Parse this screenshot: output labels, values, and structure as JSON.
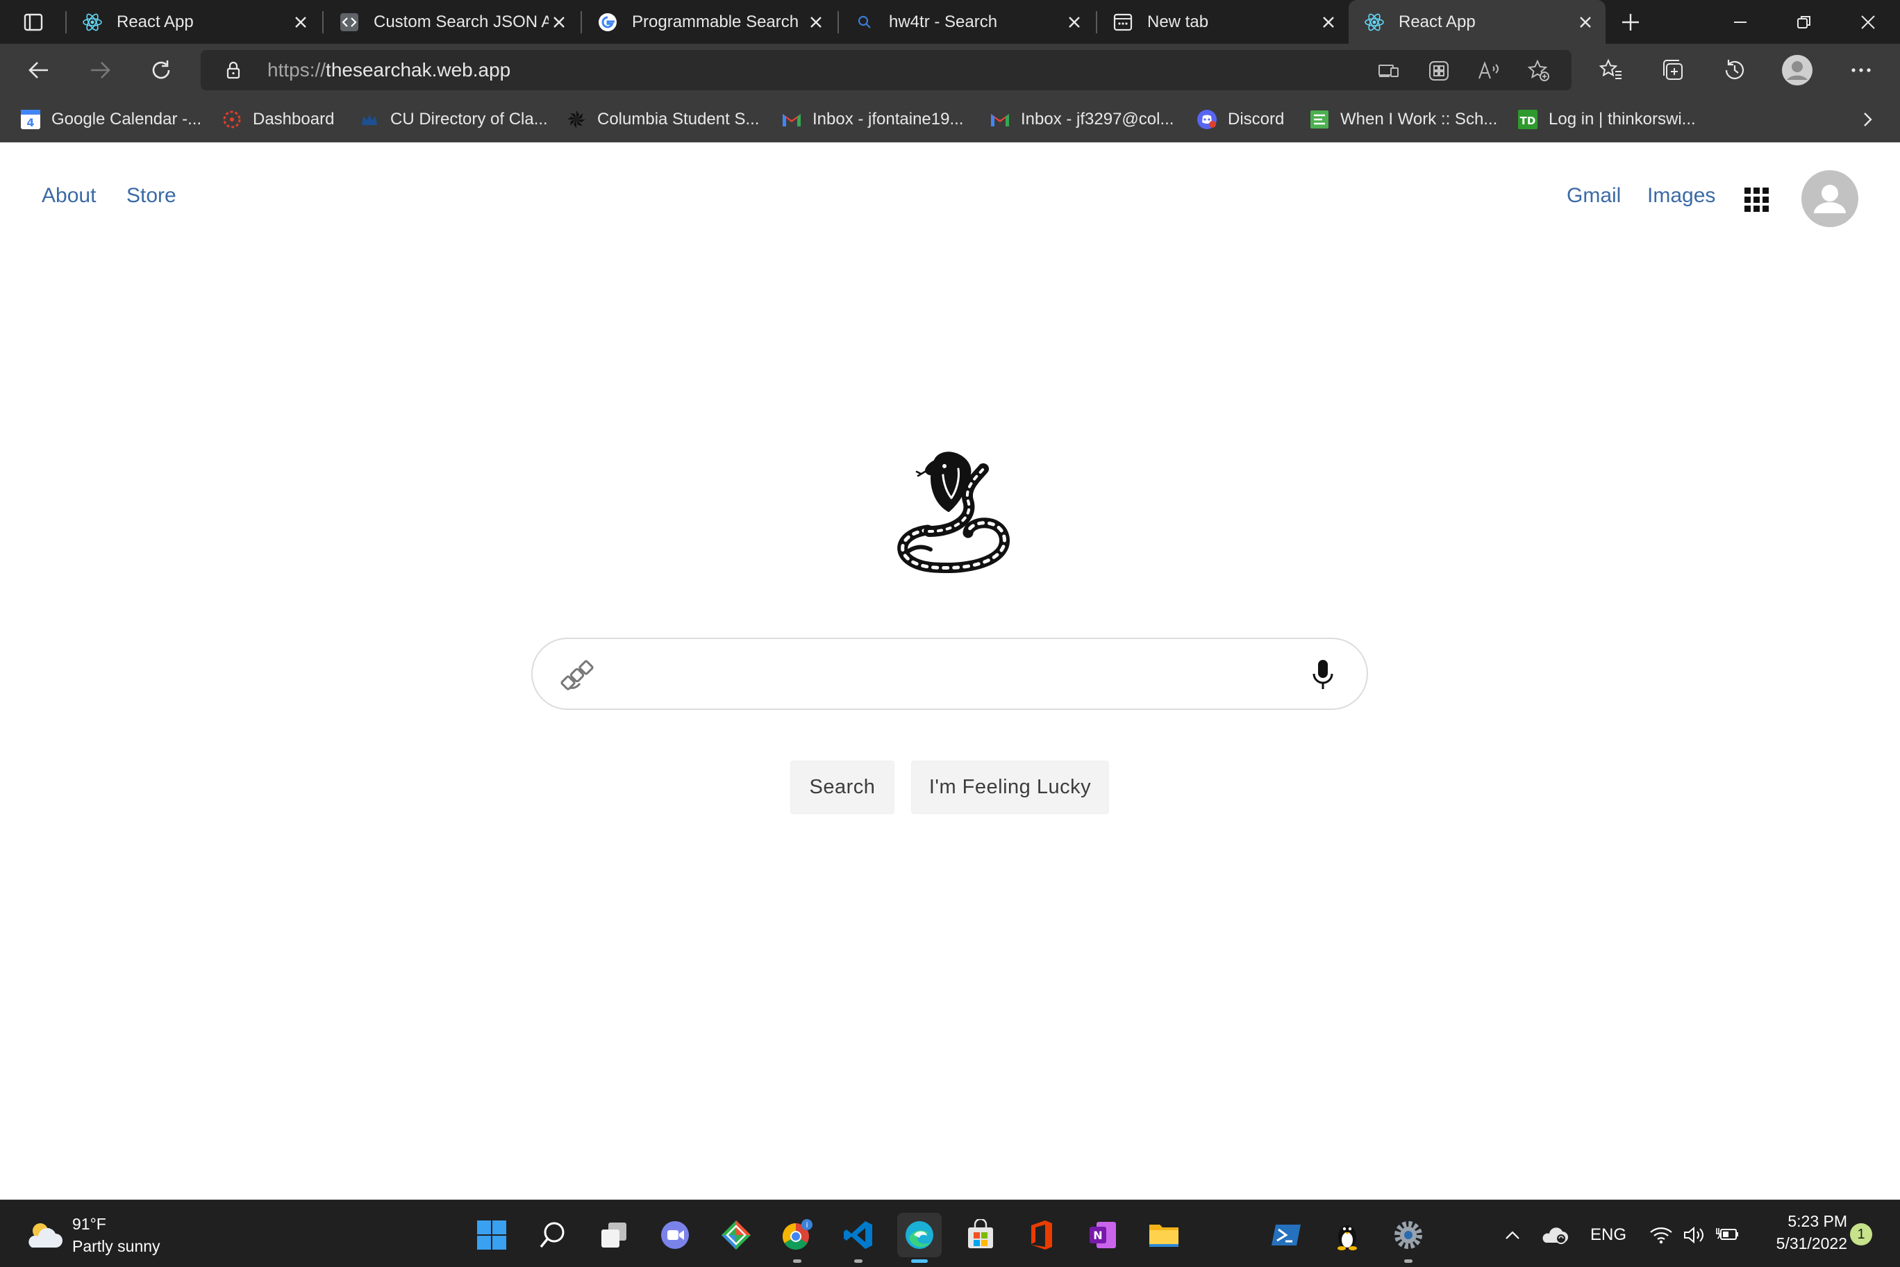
{
  "browser": {
    "tabs": [
      {
        "title": "React App",
        "icon": "react-icon",
        "active": false
      },
      {
        "title": "Custom Search JSON A",
        "icon": "api-explorer-icon",
        "active": false
      },
      {
        "title": "Programmable Search",
        "icon": "google-icon",
        "active": false
      },
      {
        "title": "hw4tr - Search",
        "icon": "search-icon",
        "active": false
      },
      {
        "title": "New tab",
        "icon": "new-tab-icon",
        "active": false
      },
      {
        "title": "React App",
        "icon": "react-icon",
        "active": true
      }
    ],
    "url_scheme": "https://",
    "url_host": "thesearchak.web.app",
    "bookmarks": [
      {
        "label": "Google Calendar -...",
        "icon": "calendar-icon",
        "color": "#4285f4"
      },
      {
        "label": "Dashboard",
        "icon": "canvas-icon",
        "color": "#e13e2e"
      },
      {
        "label": "CU Directory of Cla...",
        "icon": "crown-icon",
        "color": "#1d4f91"
      },
      {
        "label": "Columbia Student S...",
        "icon": "pinwheel-icon",
        "color": "#222222"
      },
      {
        "label": "Inbox - jfontaine19...",
        "icon": "gmail-icon",
        "color": "#ea4335"
      },
      {
        "label": "Inbox - jf3297@col...",
        "icon": "gmail-icon",
        "color": "#ea4335"
      },
      {
        "label": "Discord",
        "icon": "discord-icon",
        "color": "#5865f2"
      },
      {
        "label": "When I Work :: Sch...",
        "icon": "wheniwork-icon",
        "color": "#4caf50"
      },
      {
        "label": "Log in | thinkorswi...",
        "icon": "td-icon",
        "color": "#2e9a2e"
      }
    ]
  },
  "page": {
    "left_links": [
      "About",
      "Store"
    ],
    "right_links": [
      "Gmail",
      "Images"
    ],
    "apps_icon": "grid-icon",
    "logo": "cobra-logo",
    "search": {
      "value": "",
      "placeholder": ""
    },
    "buttons": {
      "search": "Search",
      "lucky": "I'm Feeling Lucky"
    },
    "link_color": "#3a6aa6"
  },
  "taskbar": {
    "weather_temp": "91°F",
    "weather_desc": "Partly sunny",
    "language": "ENG",
    "time": "5:23 PM",
    "date": "5/31/2022",
    "notification_count": "1",
    "accent": "#4cc2ff"
  }
}
